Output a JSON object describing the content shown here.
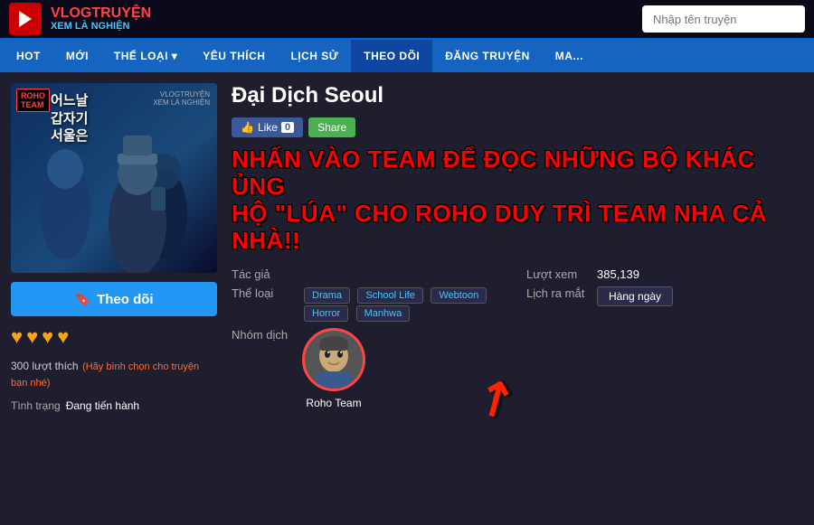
{
  "site": {
    "logo_line1": "VLOGTRUYỆN",
    "logo_line2": "XEM LÀ NGHIỆN",
    "search_placeholder": "Nhập tên truyện"
  },
  "nav": {
    "items": [
      {
        "label": "HOT",
        "active": false
      },
      {
        "label": "MỚI",
        "active": false
      },
      {
        "label": "THỂ LOẠI ▾",
        "active": false
      },
      {
        "label": "YÊU THÍCH",
        "active": false
      },
      {
        "label": "LỊCH SỬ",
        "active": false
      },
      {
        "label": "THEO DÕI",
        "active": true
      },
      {
        "label": "ĐĂNG TRUYỆN",
        "active": false
      },
      {
        "label": "MA...",
        "active": false
      }
    ]
  },
  "manga": {
    "title": "Đại Dịch Seoul",
    "cover_title1": "어느날",
    "cover_title2": "갑자기",
    "cover_title3": "서울은",
    "roho_label": "ROHO\nTEAM",
    "like_count": "0",
    "like_label": "Like",
    "share_label": "Share",
    "promo_line1": "NHẤN VÀO TEAM ĐỂ ĐỌC NHỮNG BỘ KHÁC ỦNG",
    "promo_line2": "HỘ \"LÚA\" CHO ROHO DUY TRÌ TEAM NHA CẢ NHÀ!!",
    "tac_gia_label": "Tác giả",
    "tac_gia_value": "",
    "the_loai_label": "Thể loại",
    "tags": [
      "Drama",
      "School Life",
      "Webtoon",
      "Horror",
      "Manhwa"
    ],
    "nhom_dich_label": "Nhóm dịch",
    "team_name": "Roho Team",
    "luot_xem_label": "Lượt xem",
    "luot_xem_value": "385,139",
    "lich_ra_mat_label": "Lịch ra mắt",
    "hang_ngay_label": "Hàng ngày",
    "theo_doi_label": "Theo dõi",
    "hearts": [
      "♥",
      "♥",
      "♥",
      "♥"
    ],
    "luot_thich_count": "300 lượt thích",
    "binh_chon_text": "(Hãy bình chọn cho truyện bạn nhé)",
    "tinh_trang_label": "Tình trạng",
    "tinh_trang_value": "Đang tiến hành"
  }
}
